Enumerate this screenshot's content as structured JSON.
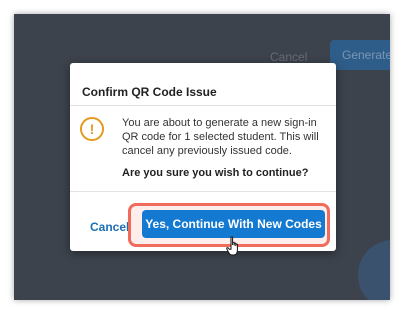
{
  "background": {
    "cancel_label": "Cancel",
    "generate_label": "Generate"
  },
  "dialog": {
    "title": "Confirm QR Code Issue",
    "icon": "warning-icon",
    "icon_glyph": "!",
    "message": "You are about to generate a new sign-in QR code for 1 selected student. This will cancel any previously issued code.",
    "confirm_question": "Are you sure you wish to continue?",
    "cancel_label": "Cancel",
    "continue_label": "Yes, Continue With New Codes"
  },
  "colors": {
    "accent": "#1479d1",
    "warning": "#e39a1e",
    "highlight": "#f06b5b",
    "overlay": "#3d434d"
  }
}
